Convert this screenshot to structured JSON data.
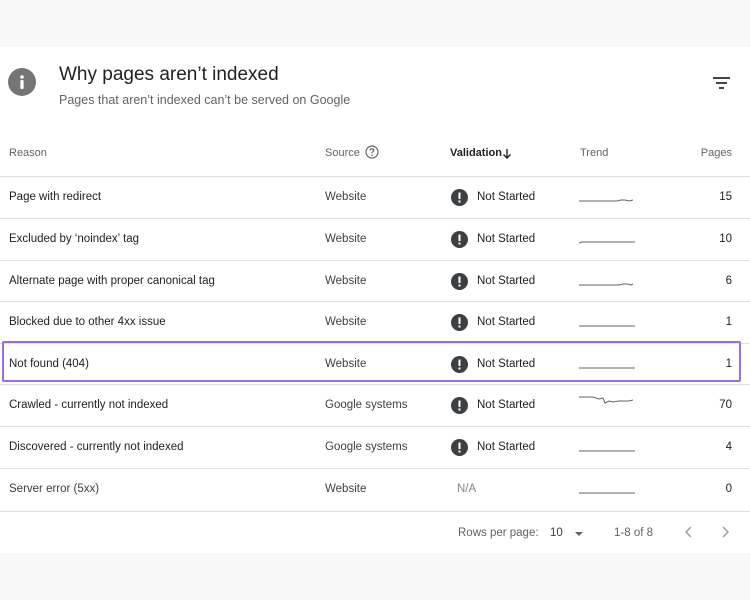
{
  "header": {
    "title": "Why pages aren’t indexed",
    "subtitle": "Pages that aren’t indexed can’t be served on Google"
  },
  "table": {
    "columns": {
      "reason": "Reason",
      "source": "Source",
      "validation": "Validation",
      "trend": "Trend",
      "pages": "Pages"
    },
    "rows": [
      {
        "reason": "Page with redirect",
        "source": "Website",
        "validation": "Not Started",
        "pages": "15"
      },
      {
        "reason": "Excluded by ‘noindex’ tag",
        "source": "Website",
        "validation": "Not Started",
        "pages": "10"
      },
      {
        "reason": "Alternate page with proper canonical tag",
        "source": "Website",
        "validation": "Not Started",
        "pages": "6"
      },
      {
        "reason": "Blocked due to other 4xx issue",
        "source": "Website",
        "validation": "Not Started",
        "pages": "1"
      },
      {
        "reason": "Not found (404)",
        "source": "Website",
        "validation": "Not Started",
        "pages": "1"
      },
      {
        "reason": "Crawled - currently not indexed",
        "source": "Google systems",
        "validation": "Not Started",
        "pages": "70"
      },
      {
        "reason": "Discovered - currently not indexed",
        "source": "Google systems",
        "validation": "Not Started",
        "pages": "4"
      },
      {
        "reason": "Server error (5xx)",
        "source": "Website",
        "validation": "N/A",
        "pages": "0"
      }
    ]
  },
  "footer": {
    "rows_per_page_label": "Rows per page:",
    "rows_per_page_value": "10",
    "range": "1-8 of 8"
  },
  "colors": {
    "highlight_border": "#9b6cf0",
    "status_icon": "#3c4043",
    "trend_line": "#5f6368"
  }
}
